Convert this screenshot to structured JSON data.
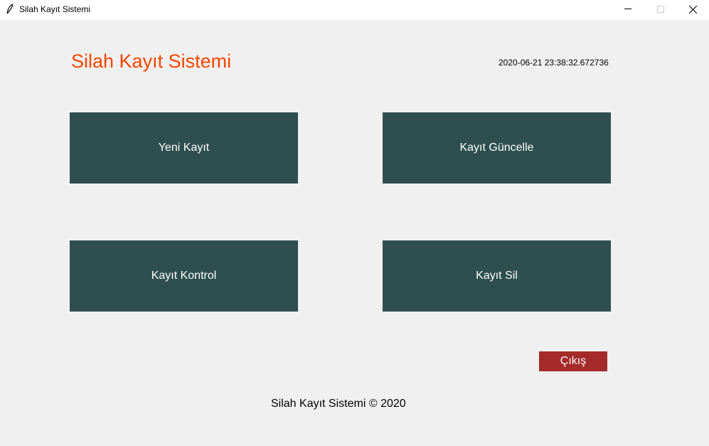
{
  "window": {
    "title": "Silah Kayıt Sistemi",
    "icon": "feather-icon"
  },
  "header": {
    "heading": "Silah Kayıt Sistemi",
    "timestamp": "2020-06-21 23:38:32.672736"
  },
  "buttons": {
    "new_record": "Yeni Kayıt",
    "update_record": "Kayıt Güncelle",
    "check_record": "Kayıt Kontrol",
    "delete_record": "Kayıt Sil",
    "exit": "Çıkış"
  },
  "footer": {
    "text": "Silah Kayıt Sistemi © 2020"
  },
  "colors": {
    "background": "#f0f0f0",
    "heading": "#ff4500",
    "button_bg": "#2f4f4f",
    "exit_bg": "#a52a2a"
  }
}
